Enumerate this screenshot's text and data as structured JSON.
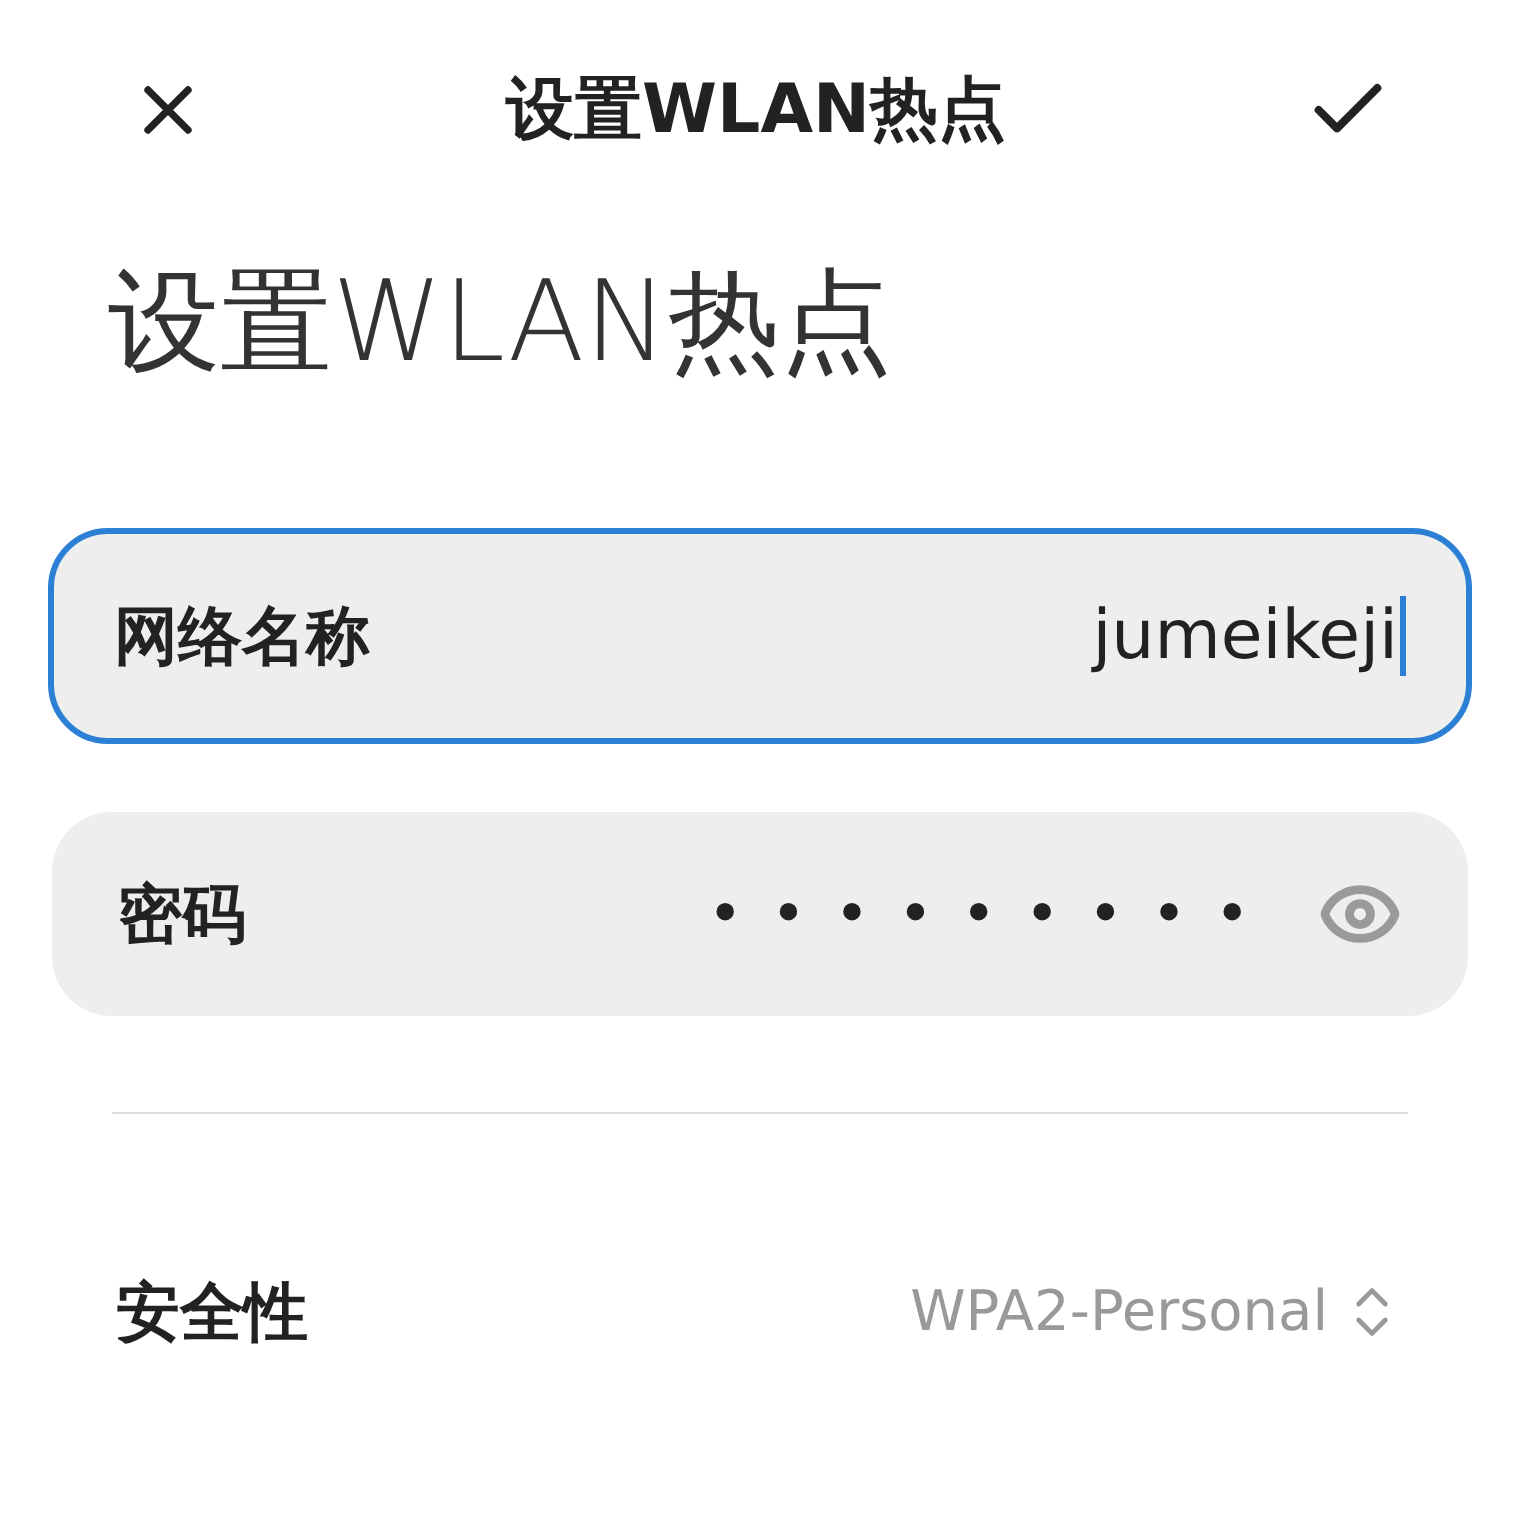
{
  "header": {
    "title": "设置WLAN热点"
  },
  "heading": "设置WLAN热点",
  "fields": [
    {
      "label": "网络名称",
      "value": "jumeikeji",
      "focused": true,
      "kind": "text"
    },
    {
      "label": "密码",
      "value": "•••••••••",
      "focused": false,
      "kind": "password"
    }
  ],
  "settings": [
    {
      "label": "安全性",
      "value": "WPA2-Personal"
    }
  ]
}
